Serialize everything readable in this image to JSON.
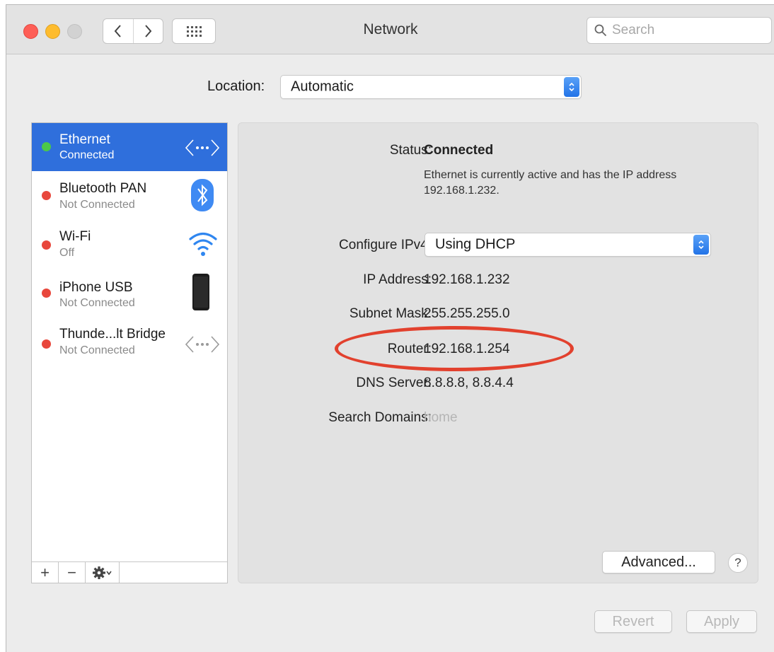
{
  "window": {
    "title": "Network",
    "search_placeholder": "Search"
  },
  "location": {
    "label": "Location:",
    "value": "Automatic"
  },
  "services": [
    {
      "name": "Ethernet",
      "status": "Connected",
      "dot_color": "#4cc84a",
      "icon": "ethernet-icon",
      "selected": true
    },
    {
      "name": "Bluetooth PAN",
      "status": "Not Connected",
      "dot_color": "#e8473c",
      "icon": "bluetooth-icon",
      "selected": false
    },
    {
      "name": "Wi-Fi",
      "status": "Off",
      "dot_color": "#e8473c",
      "icon": "wifi-icon",
      "selected": false
    },
    {
      "name": "iPhone USB",
      "status": "Not Connected",
      "dot_color": "#e8473c",
      "icon": "iphone-icon",
      "selected": false
    },
    {
      "name": "Thunde...lt Bridge",
      "status": "Not Connected",
      "dot_color": "#e8473c",
      "icon": "thunderbolt-bridge-icon",
      "selected": false
    }
  ],
  "sidebar_toolbar": {
    "add": "+",
    "remove": "−"
  },
  "detail": {
    "status_label": "Status:",
    "status_value": "Connected",
    "status_description": "Ethernet is currently active and has the IP address 192.168.1.232.",
    "configure_label": "Configure IPv4:",
    "configure_value": "Using DHCP",
    "ip_label": "IP Address:",
    "ip_value": "192.168.1.232",
    "subnet_label": "Subnet Mask:",
    "subnet_value": "255.255.255.0",
    "router_label": "Router:",
    "router_value": "192.168.1.254",
    "dns_label": "DNS Server:",
    "dns_value": "8.8.8.8, 8.8.4.4",
    "domains_label": "Search Domains:",
    "domains_value": "home"
  },
  "buttons": {
    "advanced": "Advanced...",
    "help": "?",
    "revert": "Revert",
    "apply": "Apply"
  },
  "colors": {
    "selection": "#2f6fdc",
    "annotation_circle": "#e2412e"
  }
}
